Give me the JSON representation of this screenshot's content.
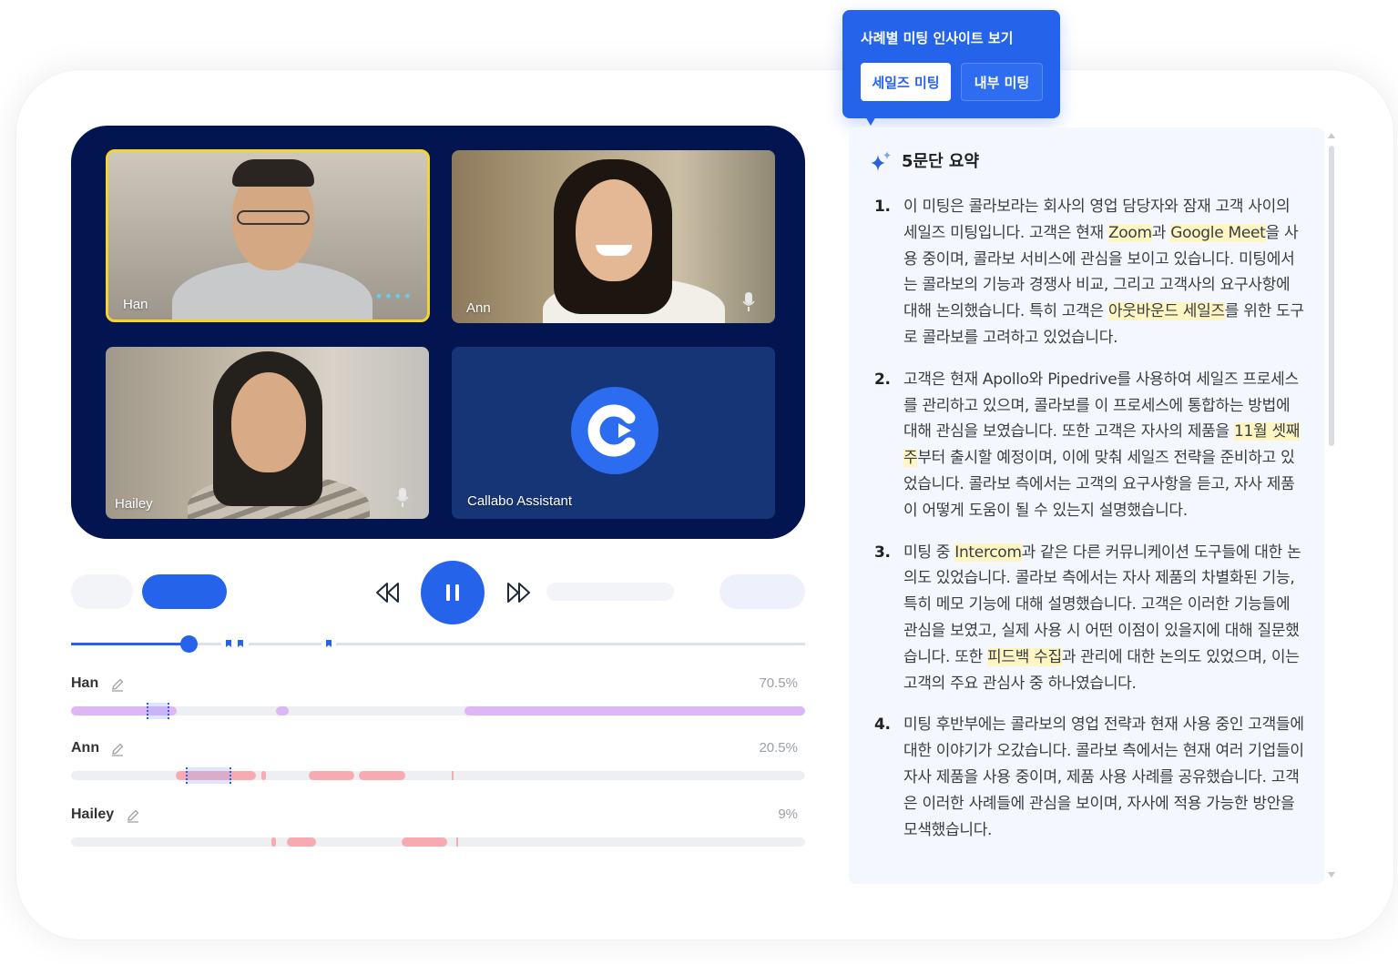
{
  "tooltip": {
    "title": "사례별 미팅 인사이트 보기",
    "tabs": [
      {
        "label": "세일즈 미팅",
        "active": true
      },
      {
        "label": "내부 미팅",
        "active": false
      }
    ]
  },
  "participants": [
    {
      "name": "Han"
    },
    {
      "name": "Ann"
    },
    {
      "name": "Hailey"
    },
    {
      "name": "Callabo Assistant"
    }
  ],
  "speakers": [
    {
      "name": "Han",
      "percent": "70.5%"
    },
    {
      "name": "Ann",
      "percent": "20.5%"
    },
    {
      "name": "Hailey",
      "percent": "9%"
    }
  ],
  "playback": {
    "progress": 0.16
  },
  "summary": {
    "title": "5문단 요약",
    "items": [
      {
        "num": "1.",
        "parts": [
          {
            "t": "이 미팅은 콜라보라는 회사의 영업 담당자와 잠재 고객 사이의 세일즈 미팅입니다. 고객은 현재 "
          },
          {
            "t": "Zoom",
            "hl": true
          },
          {
            "t": "과 "
          },
          {
            "t": "Google Meet",
            "hl": true
          },
          {
            "t": "을 사용 중이며, 콜라보 서비스에 관심을 보이고 있습니다. 미팅에서는 콜라보의 기능과 경쟁사 비교, 그리고 고객사의 요구사항에 대해 논의했습니다. 특히 고객은 "
          },
          {
            "t": "아웃바운드 세일즈",
            "hl": true
          },
          {
            "t": "를 위한 도구로 콜라보를 고려하고 있었습니다."
          }
        ]
      },
      {
        "num": "2.",
        "parts": [
          {
            "t": "고객은 현재 Apollo와 Pipedrive를 사용하여 세일즈 프로세스를 관리하고 있으며, 콜라보를 이 프로세스에 통합하는 방법에 대해 관심을 보였습니다. 또한 고객은 자사의 제품을 "
          },
          {
            "t": "11월 셋째 주",
            "hl": true
          },
          {
            "t": "부터 출시할 예정이며, 이에 맞춰 세일즈 전략을 준비하고 있었습니다. 콜라보 측에서는 고객의 요구사항을 듣고, 자사 제품이 어떻게 도움이 될 수 있는지 설명했습니다."
          }
        ]
      },
      {
        "num": "3.",
        "parts": [
          {
            "t": "미팅 중 "
          },
          {
            "t": "Intercom",
            "hl": true
          },
          {
            "t": "과 같은 다른 커뮤니케이션 도구들에 대한 논의도 있었습니다. 콜라보 측에서는 자사 제품의 차별화된 기능, 특히 메모 기능에 대해 설명했습니다. 고객은 이러한 기능들에 관심을 보였고, 실제 사용 시 어떤 이점이 있을지에 대해 질문했습니다. 또한 "
          },
          {
            "t": "피드백 수집",
            "hl": true
          },
          {
            "t": "과 관리에 대한 논의도 있었으며, 이는 고객의 주요 관심사 중 하나였습니다."
          }
        ]
      },
      {
        "num": "4.",
        "parts": [
          {
            "t": "미팅 후반부에는 콜라보의 영업 전략과 현재 사용 중인 고객들에 대한 이야기가 오갔습니다. 콜라보 측에서는 현재 여러 기업들이 자사 제품을 사용 중이며, 제품 사용 사례를 공유했습니다. 고객은 이러한 사례들에 관심을 보이며, 자사에 적용 가능한 방안을 모색했습니다."
          }
        ]
      }
    ]
  }
}
